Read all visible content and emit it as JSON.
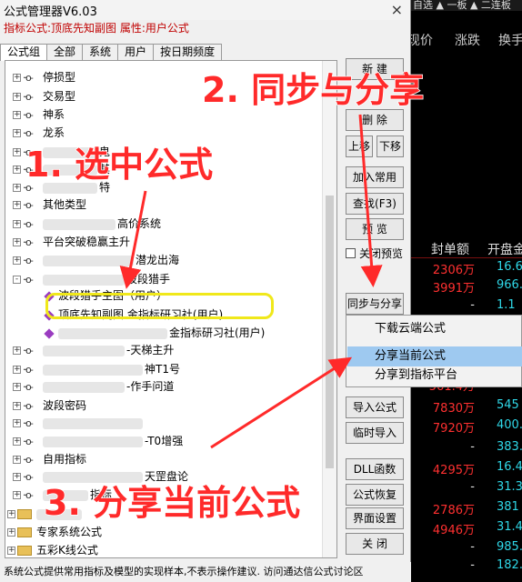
{
  "window": {
    "title": "公式管理器V6.03",
    "close_label": "×",
    "info_line": "指标公式:顶底先知副图 属性:用户公式"
  },
  "tabs": [
    "公式组",
    "全部",
    "系统",
    "用户",
    "按日期频度"
  ],
  "tree": {
    "nodes": [
      {
        "label": "停损型",
        "type": "key",
        "expand": "+"
      },
      {
        "label": "交易型",
        "type": "key",
        "expand": "+"
      },
      {
        "label": "神系",
        "type": "key",
        "expand": "+"
      },
      {
        "label": "龙系",
        "type": "key",
        "expand": "+"
      },
      {
        "label": "鬼",
        "type": "key",
        "expand": "+"
      },
      {
        "label": "其",
        "type": "key",
        "expand": "+"
      },
      {
        "label": "特",
        "type": "key",
        "expand": "+"
      },
      {
        "label": "其他类型",
        "type": "key",
        "expand": "+"
      },
      {
        "label": "高价系统",
        "type": "key",
        "expand": "+"
      },
      {
        "label": "平台突破稳赢主升",
        "type": "key",
        "expand": "+"
      },
      {
        "label": "潜龙出海",
        "type": "key",
        "expand": "+"
      },
      {
        "label": "波段猎手",
        "type": "key",
        "expand": "-"
      },
      {
        "label": "波段猎手主图（用户）",
        "type": "formula"
      },
      {
        "label": "顶底先知副图  金指标研习社(用户)",
        "type": "formula"
      },
      {
        "label": "金指标研习社(用户)",
        "type": "formula"
      },
      {
        "label": "-天梯主升",
        "type": "key",
        "expand": "+"
      },
      {
        "label": "神T1号",
        "type": "key",
        "expand": "+"
      },
      {
        "label": "-作手问道",
        "type": "key",
        "expand": "+"
      },
      {
        "label": "波段密码",
        "type": "key",
        "expand": "+"
      },
      {
        "label": "",
        "type": "key",
        "expand": "+"
      },
      {
        "label": "-T0增强",
        "type": "key",
        "expand": "+"
      },
      {
        "label": "自用指标",
        "type": "key",
        "expand": "+"
      },
      {
        "label": "天罡盘论",
        "type": "key",
        "expand": "+"
      },
      {
        "label": "指标",
        "type": "key",
        "expand": "+"
      },
      {
        "label": "",
        "type": "folder",
        "expand": "+"
      },
      {
        "label": "专家系统公式",
        "type": "folder",
        "expand": "+"
      },
      {
        "label": "五彩K线公式",
        "type": "folder",
        "expand": "+"
      }
    ]
  },
  "buttons": {
    "new": "新 建",
    "delete": "删 除",
    "up": "上移",
    "down": "下移",
    "add_common": "加入常用",
    "find": "查找(F3)",
    "preview": "预 览",
    "close_preview": "关闭预览",
    "sync_share": "同步与分享",
    "import": "导入公式",
    "temp_import": "临时导入",
    "dll": "DLL函数",
    "restore": "公式恢复",
    "ui_settings": "界面设置",
    "close": "关 闭"
  },
  "context_menu": {
    "items": [
      "下载云端公式",
      "分享当前公式",
      "分享到指标平台"
    ],
    "highlighted_index": 1
  },
  "statusbar": "系统公式提供常用指标及模型的实现样本,不表示操作建议.   访问通达信公式讨论区",
  "annotations": {
    "step1": "1. 选中公式",
    "step2": "2. 同步与分享",
    "step3": "3. 分享当前公式"
  },
  "stock_panel": {
    "tabs": "自选 ▲ 一板 ▲ 二连板",
    "header1": [
      "现价",
      "涨跌",
      "换手"
    ],
    "header2": [
      "封单额",
      "开盘金"
    ],
    "rows": [
      {
        "a": "2306万",
        "b": "16.6",
        "ca": "red",
        "cb": "cyan"
      },
      {
        "a": "3991万",
        "b": "966.",
        "ca": "red",
        "cb": "cyan"
      },
      {
        "a": "-",
        "b": "1.1",
        "ca": "white",
        "cb": "cyan"
      },
      {
        "a": "561.4万",
        "b": "057.",
        "ca": "red",
        "cb": "cyan"
      },
      {
        "a": "7830万",
        "b": "545",
        "ca": "red",
        "cb": "cyan"
      },
      {
        "a": "7920万",
        "b": "400.",
        "ca": "red",
        "cb": "cyan"
      },
      {
        "a": "-",
        "b": "383.",
        "ca": "white",
        "cb": "cyan"
      },
      {
        "a": "4295万",
        "b": "16.4",
        "ca": "red",
        "cb": "cyan"
      },
      {
        "a": "-",
        "b": "31.3",
        "ca": "white",
        "cb": "cyan"
      },
      {
        "a": "2786万",
        "b": "381",
        "ca": "red",
        "cb": "cyan"
      },
      {
        "a": "4946万",
        "b": "31.4",
        "ca": "red",
        "cb": "cyan"
      },
      {
        "a": "-",
        "b": "985.",
        "ca": "white",
        "cb": "cyan"
      },
      {
        "a": "-",
        "b": "182.",
        "ca": "white",
        "cb": "cyan"
      }
    ]
  },
  "colors": {
    "annotation_red": "#ff2a2a",
    "highlight_yellow": "#f0e81a",
    "menu_highlight": "#9ec9f0",
    "stock_red": "#ff3030",
    "stock_cyan": "#2fd8e8"
  }
}
